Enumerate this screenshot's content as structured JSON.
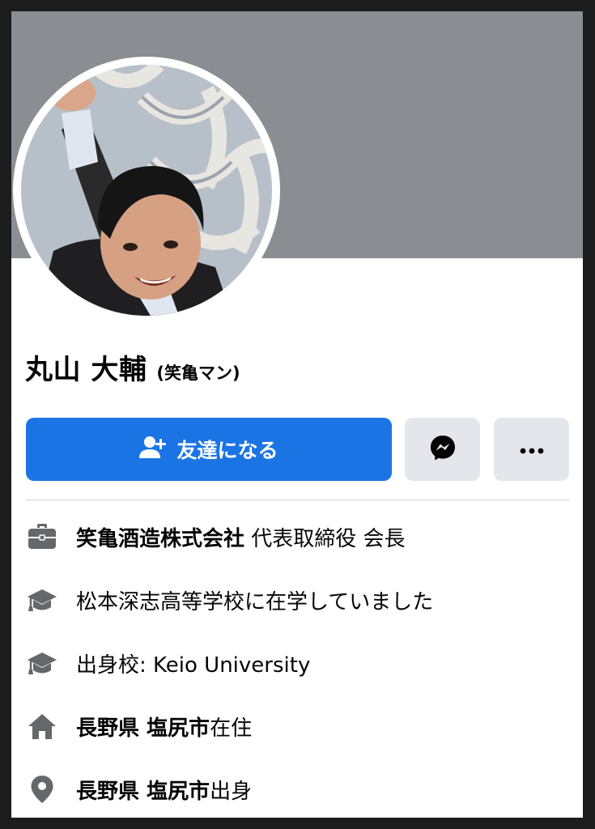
{
  "profile": {
    "name": "丸山 大輔",
    "nickname": "(笑亀マン)"
  },
  "actions": {
    "add_friend_label": "友達になる",
    "add_friend_icon": "add-friend-icon",
    "messenger_icon": "messenger-icon",
    "more_icon": "more-icon",
    "primary_color": "#1b74e4",
    "secondary_color": "#e4e6eb"
  },
  "info": {
    "work": {
      "icon": "briefcase-icon",
      "company": "笑亀酒造株式会社",
      "position": " 代表取締役 会長"
    },
    "education_1": {
      "icon": "graduation-cap-icon",
      "text": "松本深志高等学校に在学していました"
    },
    "education_2": {
      "icon": "graduation-cap-icon",
      "text": "出身校: Keio University"
    },
    "lives": {
      "icon": "home-icon",
      "place": "長野県 塩尻市",
      "suffix": "在住"
    },
    "from": {
      "icon": "location-pin-icon",
      "place": "長野県 塩尻市",
      "suffix": "出身"
    }
  },
  "colors": {
    "cover": "#8a8d91",
    "text": "#050505",
    "icon": "#65676b"
  }
}
